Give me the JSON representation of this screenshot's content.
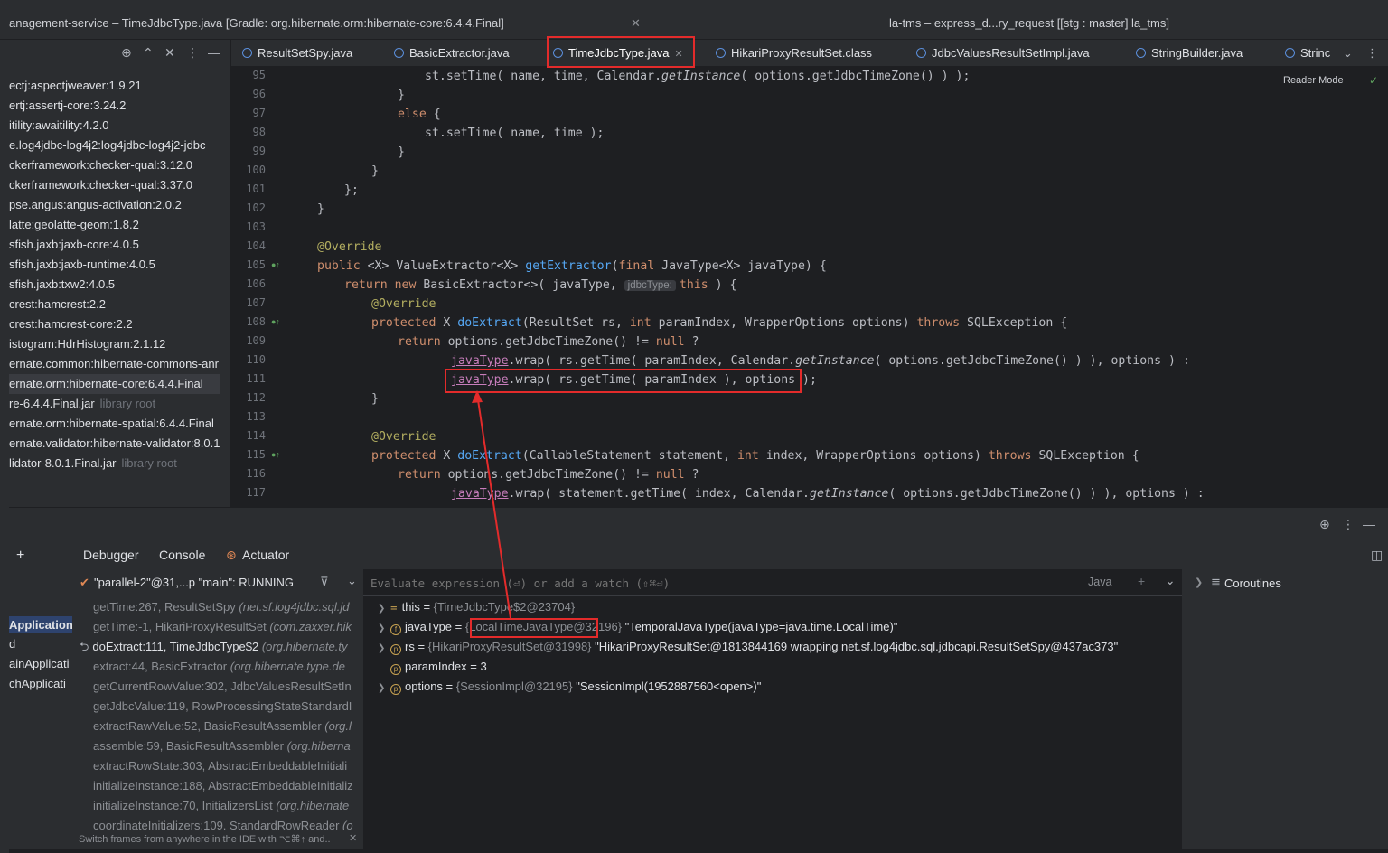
{
  "window": {
    "title_left": "anagement-service – TimeJdbcType.java [Gradle: org.hibernate.orm:hibernate-core:6.4.4.Final]",
    "title_right": "la-tms – express_d...ry_request [[stg : master] la_tms]"
  },
  "project_tree": {
    "items": [
      {
        "label": "ectj:aspectjweaver:1.9.21"
      },
      {
        "label": "ertj:assertj-core:3.24.2"
      },
      {
        "label": "itility:awaitility:4.2.0"
      },
      {
        "label": "e.log4jdbc-log4j2:log4jdbc-log4j2-jdbc"
      },
      {
        "label": "ckerframework:checker-qual:3.12.0"
      },
      {
        "label": "ckerframework:checker-qual:3.37.0"
      },
      {
        "label": "pse.angus:angus-activation:2.0.2"
      },
      {
        "label": "latte:geolatte-geom:1.8.2"
      },
      {
        "label": "sfish.jaxb:jaxb-core:4.0.5"
      },
      {
        "label": "sfish.jaxb:jaxb-runtime:4.0.5"
      },
      {
        "label": "sfish.jaxb:txw2:4.0.5"
      },
      {
        "label": "crest:hamcrest:2.2"
      },
      {
        "label": "crest:hamcrest-core:2.2"
      },
      {
        "label": "istogram:HdrHistogram:2.1.12"
      },
      {
        "label": "ernate.common:hibernate-commons-anr"
      },
      {
        "label": "ernate.orm:hibernate-core:6.4.4.Final"
      },
      {
        "label": "re-6.4.4.Final.jar",
        "suffix": "library root"
      },
      {
        "label": "ernate.orm:hibernate-spatial:6.4.4.Final"
      },
      {
        "label": "ernate.validator:hibernate-validator:8.0.1"
      },
      {
        "label": "lidator-8.0.1.Final.jar",
        "suffix": "library root"
      }
    ]
  },
  "editor_tabs": [
    {
      "label": "ResultSetSpy.java"
    },
    {
      "label": "BasicExtractor.java"
    },
    {
      "label": "TimeJdbcType.java"
    },
    {
      "label": "HikariProxyResultSet.class"
    },
    {
      "label": "JdbcValuesResultSetImpl.java"
    },
    {
      "label": "StringBuilder.java"
    },
    {
      "label": "Strinc"
    }
  ],
  "reader_mode": "Reader Mode",
  "code": {
    "line_numbers": [
      "95",
      "96",
      "97",
      "98",
      "99",
      "100",
      "101",
      "102",
      "103",
      "104",
      "105",
      "106",
      "107",
      "108",
      "109",
      "110",
      "111",
      "112",
      "113",
      "114",
      "115",
      "116",
      "117"
    ],
    "l95": "st.setTime( name, time, Calendar.",
    "l95b": "getInstance",
    "l95c": "( options.getJdbcTimeZone() ) );",
    "l96": "}",
    "l97kw": "else",
    "l97": " {",
    "l98": "st.setTime( name, time );",
    "l99": "}",
    "l100": "}",
    "l101": "};",
    "l102": "}",
    "l104": "@Override",
    "l105a": "public",
    "l105b": " <X> ValueExtractor<X> ",
    "l105c": "getExtractor",
    "l105d": "(",
    "l105e": "final",
    "l105f": " JavaType<X> javaType) {",
    "l106a": "return new",
    "l106b": " BasicExtractor<>( javaType, ",
    "l106hint": "jdbcType:",
    "l106c": "this",
    "l106d": " ) {",
    "l107": "@Override",
    "l108a": "protected",
    "l108b": " X ",
    "l108c": "doExtract",
    "l108d": "(ResultSet rs, ",
    "l108e": "int",
    "l108f": " paramIndex, WrapperOptions options) ",
    "l108g": "throws",
    "l108h": " SQLException {",
    "l109a": "return",
    "l109b": " options.getJdbcTimeZone() != ",
    "l109c": "null",
    "l109d": " ?",
    "l110a": "javaType",
    "l110b": ".wrap( rs.getTime( paramIndex, Calendar.",
    "l110c": "getInstance",
    "l110d": "( options.getJdbcTimeZone() ) ), options ) :",
    "l111a": "javaType",
    "l111b": ".wrap( rs.getTime( paramIndex ), options );",
    "l112": "}",
    "l114": "@Override",
    "l115a": "protected",
    "l115b": " X ",
    "l115c": "doExtract",
    "l115d": "(CallableStatement statement, ",
    "l115e": "int",
    "l115f": " index, WrapperOptions options) ",
    "l115g": "throws",
    "l115h": " SQLException {",
    "l116a": "return",
    "l116b": " options.getJdbcTimeZone() != ",
    "l116c": "null",
    "l116d": " ?",
    "l117a": "javaType",
    "l117b": ".wrap( statement.getTime( index, Calendar.",
    "l117c": "getInstance",
    "l117d": "( options.getJdbcTimeZone() ) ), options ) :"
  },
  "debug_tabs": {
    "debugger": "Debugger",
    "console": "Console",
    "actuator": "Actuator"
  },
  "thread": "\"parallel-2\"@31,...p \"main\": RUNNING",
  "left_debug": [
    "Application",
    "d",
    "ainApplicati",
    "chApplicati"
  ],
  "frames": [
    {
      "method": "getTime:267, ResultSetSpy ",
      "cls": "(net.sf.log4jdbc.sql.jd"
    },
    {
      "method": "getTime:-1, HikariProxyResultSet ",
      "cls": "(com.zaxxer.hik"
    },
    {
      "method": "doExtract:111, TimeJdbcType$2 ",
      "cls": "(org.hibernate.ty"
    },
    {
      "method": "extract:44, BasicExtractor ",
      "cls": "(org.hibernate.type.de"
    },
    {
      "method": "getCurrentRowValue:302, JdbcValuesResultSetIn",
      "cls": ""
    },
    {
      "method": "getJdbcValue:119, RowProcessingStateStandardI",
      "cls": ""
    },
    {
      "method": "extractRawValue:52, BasicResultAssembler ",
      "cls": "(org.l"
    },
    {
      "method": "assemble:59, BasicResultAssembler ",
      "cls": "(org.hiberna"
    },
    {
      "method": "extractRowState:303, AbstractEmbeddableInitiali",
      "cls": ""
    },
    {
      "method": "initializeInstance:188, AbstractEmbeddableInitializ",
      "cls": ""
    },
    {
      "method": "initializeInstance:70, InitializersList ",
      "cls": "(org.hibernate"
    },
    {
      "method": "coordinateInitializers:109, StandardRowReader ",
      "cls": "(o"
    }
  ],
  "frames_hint": "Switch frames from anywhere in the IDE with ⌥⌘↑ and..",
  "eval": {
    "placeholder": "Evaluate expression (⏎) or add a watch (⇧⌘⏎)",
    "lang": "Java"
  },
  "variables": [
    {
      "icon": "≡",
      "name": "this",
      "ref": "{TimeJdbcType$2@23704}",
      "value": ""
    },
    {
      "icon": "f",
      "name": "javaType",
      "ref": "{LocalTimeJavaType@32196}",
      "value": "\"TemporalJavaType(javaType=java.time.LocalTime)\""
    },
    {
      "icon": "p",
      "name": "rs",
      "ref": "{HikariProxyResultSet@31998}",
      "value": "\"HikariProxyResultSet@1813844169 wrapping net.sf.log4jdbc.sql.jdbcapi.ResultSetSpy@437ac373\""
    },
    {
      "icon": "p",
      "name": "paramIndex",
      "ref": "",
      "value": "3"
    },
    {
      "icon": "p",
      "name": "options",
      "ref": "{SessionImpl@32195}",
      "value": "\"SessionImpl(1952887560<open>)\""
    }
  ],
  "coroutines": "Coroutines"
}
